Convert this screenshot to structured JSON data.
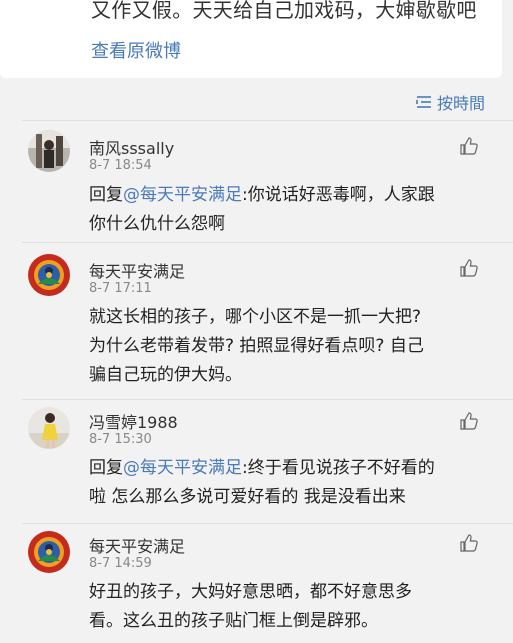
{
  "post": {
    "text_tail": "又作又假。天天给自己加戏码，大婶歇歇吧",
    "view_original": "查看原微博"
  },
  "sort": {
    "label": "按時間",
    "icon": "sort-list-icon"
  },
  "comments": [
    {
      "name": "南风sssally",
      "time": "8-7 18:54",
      "reply_prefix": "回复",
      "mention": "@每天平安满足",
      "text_line1": ":你说话好恶毒啊，人家跟",
      "text_line2": "你什么仇什么怨啊",
      "avatar": "photo-avatar"
    },
    {
      "name": "每天平安满足",
      "time": "8-7 17:11",
      "text_lines": [
        "就这长相的孩子，哪个小区不是一抓一大把?",
        "为什么老带着发带? 拍照显得好看点呗? 自己",
        "骗自己玩的伊大妈。"
      ],
      "avatar": "deity-avatar"
    },
    {
      "name": "冯雪婷1988",
      "time": "8-7 15:30",
      "reply_prefix": "回复",
      "mention": "@每天平安满足",
      "text_line1": ":终于看见说孩子不好看的",
      "text_line2": "啦 怎么那么多说可爱好看的 我是没看出来",
      "avatar": "girl-avatar"
    },
    {
      "name": "每天平安满足",
      "time": "8-7 14:59",
      "text_lines": [
        "好丑的孩子，大妈好意思晒，都不好意思多",
        "看。这么丑的孩子贴门框上倒是辟邪。"
      ],
      "avatar": "deity-avatar"
    }
  ],
  "colors": {
    "link": "#4a7ab8",
    "background": "#f2f2f2",
    "card": "#ffffff"
  }
}
